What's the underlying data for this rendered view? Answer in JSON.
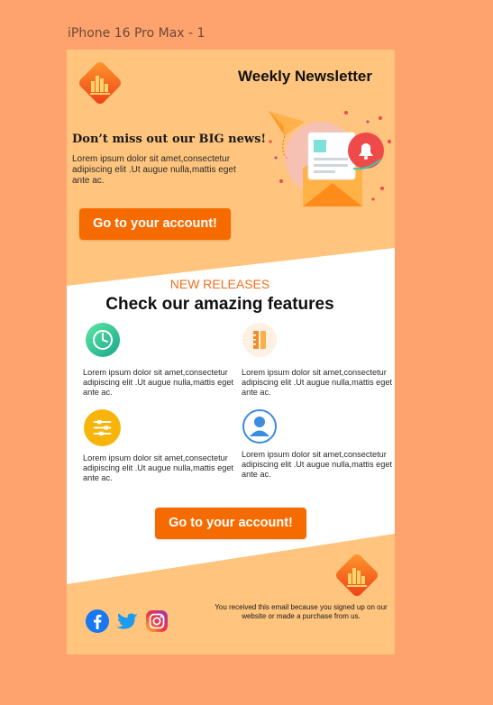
{
  "canvas_label": "iPhone 16 Pro Max - 1",
  "header": {
    "title": "Weekly Newsletter"
  },
  "hero": {
    "headline": "Don’t miss out  our BIG news!",
    "body": "Lorem ipsum dolor sit amet,consectetur adipiscing elit  .Ut augue nulla,mattis eget ante ac.",
    "cta": "Go to your account!"
  },
  "features_section": {
    "kicker": "NEW RELEASES",
    "title": "Check our amazing features",
    "items": [
      {
        "icon": "clock-icon",
        "text": "Lorem ipsum dolor sit amet,consectetur adipiscing elit  .Ut augue nulla,mattis eget ante ac."
      },
      {
        "icon": "ruler-pencil-icon",
        "text": "Lorem ipsum dolor sit amet,consectetur adipiscing elit  .Ut augue nulla,mattis eget ante ac."
      },
      {
        "icon": "sliders-icon",
        "text": "Lorem ipsum dolor sit amet,consectetur adipiscing elit  .Ut augue nulla,mattis eget ante ac."
      },
      {
        "icon": "user-icon",
        "text": "Lorem ipsum dolor sit amet,consectetur adipiscing elit  .Ut augue nulla,mattis eget ante ac."
      }
    ],
    "cta": "Go to your account!"
  },
  "footer": {
    "note": "You received this email because you signed up on our website or made a purchase from us.",
    "social": [
      "facebook-icon",
      "twitter-icon",
      "instagram-icon"
    ]
  },
  "colors": {
    "page_bg": "#ffa36e",
    "frame_bg": "#ffc47d",
    "accent": "#f56b00",
    "kicker": "#f07020"
  }
}
